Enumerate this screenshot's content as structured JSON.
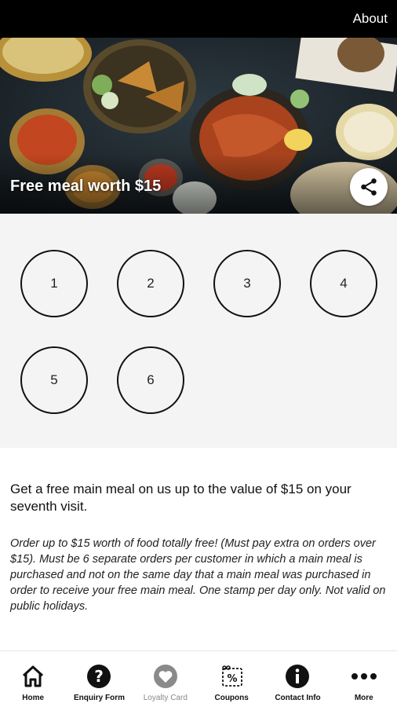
{
  "topbar": {
    "about_label": "About"
  },
  "hero": {
    "title": "Free meal worth $15",
    "share_icon": "share-icon"
  },
  "stamps": {
    "items": [
      {
        "number": "1"
      },
      {
        "number": "2"
      },
      {
        "number": "3"
      },
      {
        "number": "4"
      },
      {
        "number": "5"
      },
      {
        "number": "6"
      }
    ]
  },
  "content": {
    "description": "Get a free main meal on us up to the value of $15 on your seventh visit.",
    "terms": "Order up to $15 worth of food totally free! (Must pay extra on orders over $15). Must be 6 separate orders per customer in which a main meal is purchased and not on the same day that a main meal was purchased in order to receive your free main meal. One stamp per day only. Not valid on public holidays."
  },
  "nav": {
    "items": [
      {
        "label": "Home",
        "icon": "home-icon",
        "active": false
      },
      {
        "label": "Enquiry Form",
        "icon": "question-icon",
        "active": false
      },
      {
        "label": "Loyalty Card",
        "icon": "heart-icon",
        "active": true
      },
      {
        "label": "Coupons",
        "icon": "coupon-icon",
        "active": false
      },
      {
        "label": "Contact Info",
        "icon": "info-icon",
        "active": false
      },
      {
        "label": "More",
        "icon": "more-icon",
        "active": false
      }
    ]
  },
  "colors": {
    "topbar_bg": "#000000",
    "stamp_area_bg": "#f4f4f4",
    "inactive_nav_label": "#888888"
  }
}
